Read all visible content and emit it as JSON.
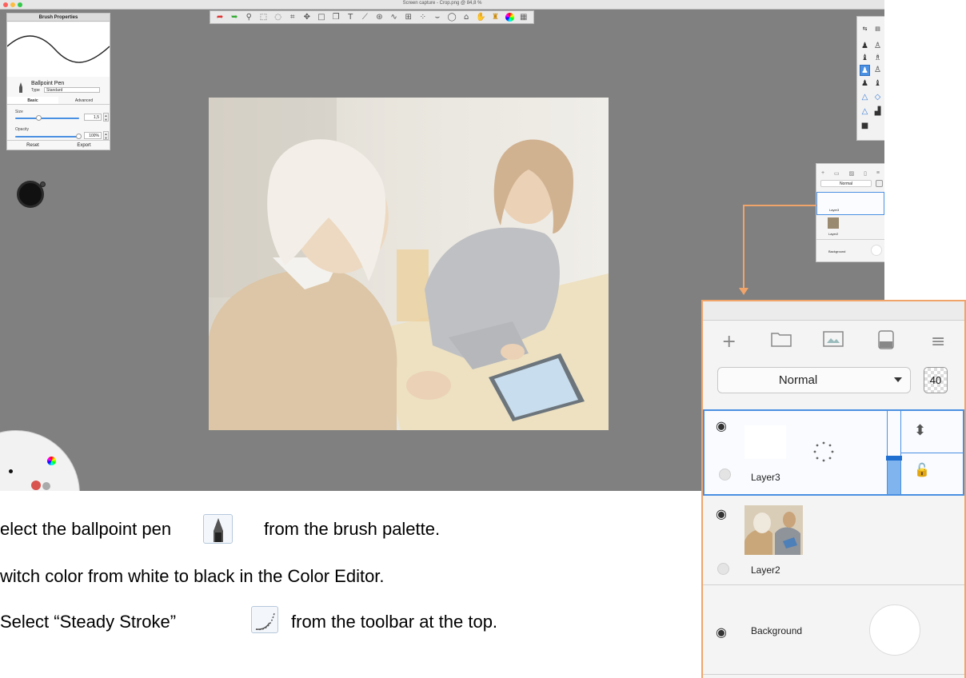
{
  "window": {
    "title": "Screen capture - Crop.png @ 84,8 %"
  },
  "toolbar": {
    "tools": [
      "undo-icon",
      "redo-icon",
      "zoom-icon",
      "select-icon",
      "lasso-icon",
      "crop-icon",
      "transform-icon",
      "rect-icon",
      "copy-icon",
      "text-icon",
      "ruler-icon",
      "symmetry-icon",
      "curve-icon",
      "perspective-icon",
      "distort-icon",
      "steady-stroke-icon",
      "ellipse-icon",
      "fill-icon",
      "paint-icon",
      "brush-library-icon",
      "color-wheel-icon",
      "layers-icon"
    ]
  },
  "brush_properties": {
    "title": "Brush Properties",
    "brush_name": "Ballpoint Pen",
    "type_label": "Type",
    "type_value": "Standard",
    "tabs": [
      "Basic",
      "Advanced"
    ],
    "size_label": "Size",
    "size_value": "1,5",
    "opacity_label": "Opacity",
    "opacity_value": "100%",
    "reset_label": "Reset",
    "export_label": "Export"
  },
  "layers_small": {
    "blend": "Normal",
    "layers": [
      "Layer3",
      "Layer2",
      "Background"
    ]
  },
  "layers_panel": {
    "blend_mode": "Normal",
    "opacity": "40",
    "layers": [
      {
        "name": "Layer3"
      },
      {
        "name": "Layer2"
      },
      {
        "name": "Background"
      }
    ]
  },
  "instructions": {
    "step1_prefix": "elect the ballpoint pen",
    "step1_suffix": "from the brush palette.",
    "step2": "witch color from white to black in the Color Editor.",
    "step3_prefix": "Select “Steady Stroke”",
    "step3_suffix": "from the toolbar at the top."
  },
  "colors": {
    "accent": "#4a90e2",
    "highlight_border": "#f0a46a",
    "app_background": "#808080"
  }
}
